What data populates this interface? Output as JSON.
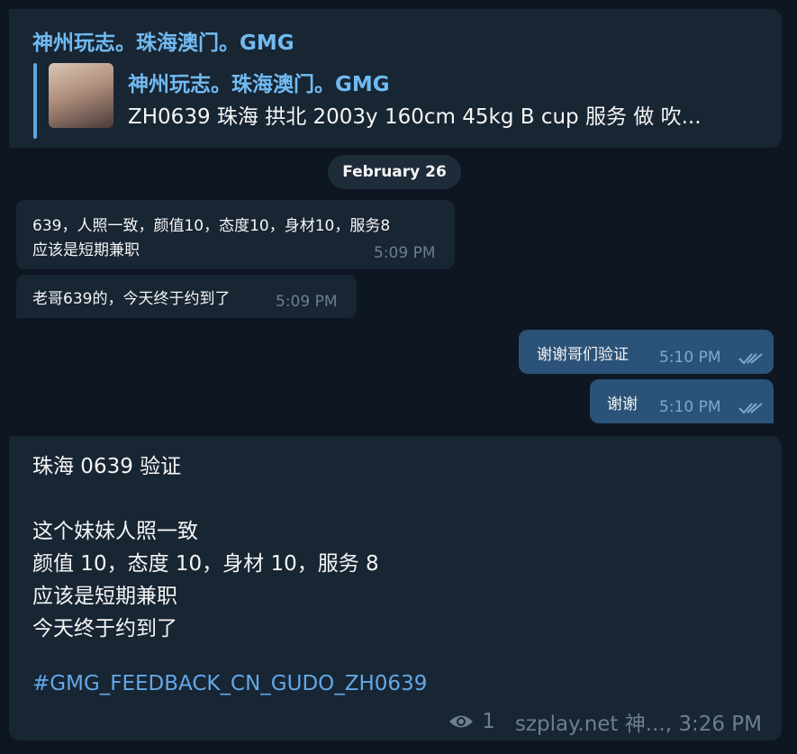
{
  "top_card": {
    "channel_name": "神州玩志。珠海澳门。GMG",
    "reply_title": "神州玩志。珠海澳门。GMG",
    "reply_text": "ZH0639 珠海 拱北 2003y  160cm  45kg  B cup  服务 做 吹..."
  },
  "date_pill": "February 26",
  "messages": [
    {
      "lines": [
        "639，人照一致，颜值10，态度10，身材10，服务8",
        "应该是短期兼职"
      ],
      "time": "5:09 PM"
    },
    {
      "lines": [
        "老哥639的，今天终于约到了"
      ],
      "time": "5:09 PM"
    },
    {
      "lines": [
        "谢谢哥们验证"
      ],
      "time": "5:10 PM"
    },
    {
      "lines": [
        "谢谢"
      ],
      "time": "5:10 PM"
    }
  ],
  "big_card": {
    "lines": [
      "珠海 0639 验证",
      "",
      "这个妹妹人照一致",
      "颜值 10，态度 10，身材 10，服务 8",
      "应该是短期兼职",
      "今天终于约到了"
    ],
    "hashtag": "#GMG_FEEDBACK_CN_GUDO_ZH0639",
    "views": "1",
    "footer_meta": "szplay.net 神..., 3:26 PM"
  },
  "colors": {
    "background": "#0e1621",
    "bubble_in": "#182533",
    "bubble_out": "#2b5278",
    "link": "#71baf1"
  }
}
